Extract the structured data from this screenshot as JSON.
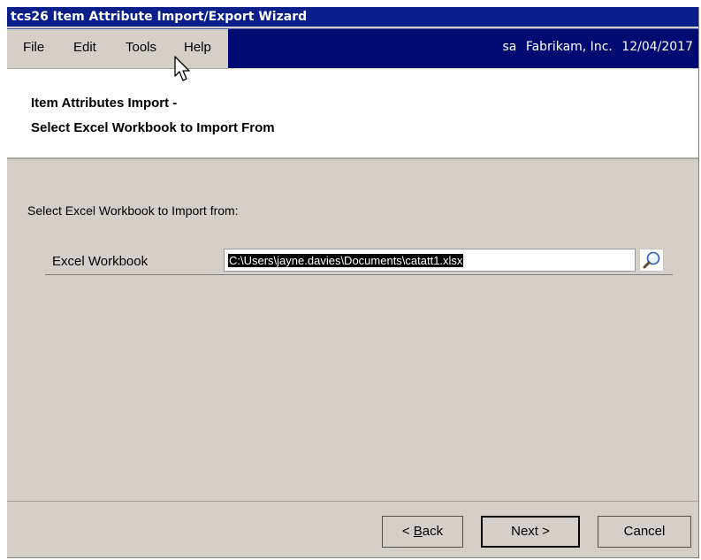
{
  "window": {
    "title": "tcs26 Item Attribute Import/Export Wizard"
  },
  "menu": {
    "items": [
      "File",
      "Edit",
      "Tools",
      "Help"
    ]
  },
  "user_info": {
    "user": "sa",
    "company": "Fabrikam, Inc.",
    "date": "12/04/2017"
  },
  "header": {
    "line1": "Item Attributes Import -",
    "line2": "Select Excel Workbook to Import From"
  },
  "prompt": "Select Excel Workbook to Import from:",
  "field": {
    "label": "Excel Workbook",
    "value": "C:\\Users\\jayne.davies\\Documents\\catatt1.xlsx"
  },
  "buttons": {
    "back_prefix": "< ",
    "back_mnemonic": "B",
    "back_rest": "ack",
    "next": "Next >",
    "cancel": "Cancel"
  },
  "icons": {
    "lookup": "magnifier-icon",
    "cursor": "mouse-pointer-icon"
  },
  "colors": {
    "titlebar": "#0a1f8a",
    "menubar_right": "#000a73",
    "panel": "#d4d0c8",
    "selection": "#000000"
  }
}
